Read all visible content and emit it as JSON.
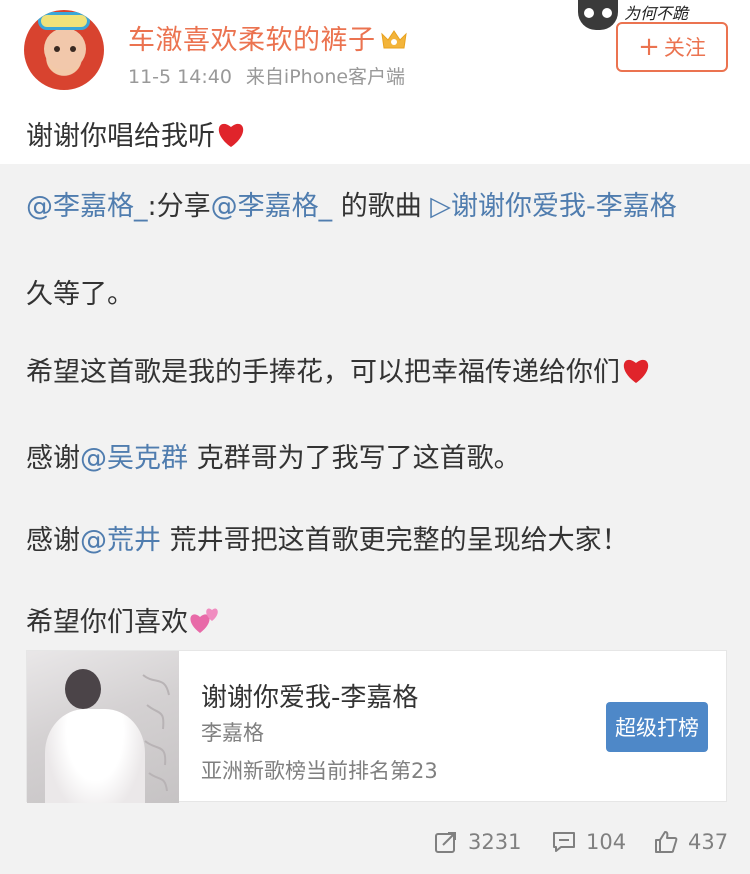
{
  "header": {
    "username": "车澈喜欢柔软的裤子",
    "time": "11-5 14:40",
    "source": "来自iPhone客户端",
    "follow_label": "关注",
    "deco_text": "为何不跪"
  },
  "post": {
    "text": "谢谢你唱给我听"
  },
  "repost": {
    "share_mention": "@李嘉格_",
    "share_colon": ":分享",
    "share_mention2": "@李嘉格_",
    "share_mid": " 的歌曲 ",
    "share_song_link": "▷谢谢你爱我-李嘉格",
    "line1": "久等了。",
    "line2": "希望这首歌是我的手捧花，可以把幸福传递给你们",
    "line3_pre": "感谢",
    "line3_mention": "@吴克群",
    "line3_post": " 克群哥为了我写了这首歌。",
    "line4_pre": "感谢",
    "line4_mention": "@荒井",
    "line4_post": " 荒井哥把这首歌更完整的呈现给大家！",
    "line5": "希望你们喜欢"
  },
  "music_card": {
    "title": "谢谢你爱我-李嘉格",
    "artist": "李嘉格",
    "rank": "亚洲新歌榜当前排名第23",
    "button": "超级打榜"
  },
  "actions": {
    "repost_count": "3231",
    "comment_count": "104",
    "like_count": "437"
  },
  "colors": {
    "username": "#eb7350",
    "mention": "#507daf",
    "rank_button": "#4e88c8",
    "repost_bg": "#f2f2f2"
  }
}
